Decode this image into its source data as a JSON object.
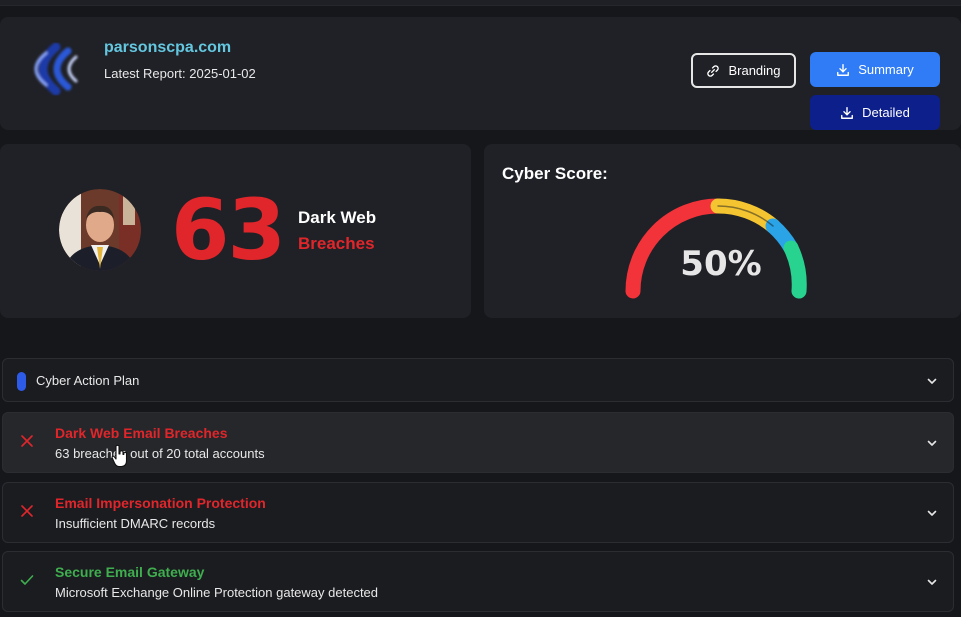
{
  "header": {
    "site_name": "parsonscpa.com",
    "latest_report_label": "Latest Report: 2025-01-02",
    "buttons": {
      "branding": "Branding",
      "summary": "Summary",
      "detailed": "Detailed"
    }
  },
  "breaches_card": {
    "count": "63",
    "label_line1": "Dark Web",
    "label_line2": "Breaches"
  },
  "score_card": {
    "title": "Cyber Score:",
    "value_text": "50%",
    "value": 50
  },
  "action_plan": {
    "label": "Cyber Action Plan"
  },
  "checks": [
    {
      "title": "Dark Web Email Breaches",
      "detail": "63 breaches out of 20 total accounts",
      "status": "fail"
    },
    {
      "title": "Email Impersonation Protection",
      "detail": "Insufficient DMARC records",
      "status": "fail"
    },
    {
      "title": "Secure Email Gateway",
      "detail": "Microsoft Exchange Online Protection gateway detected",
      "status": "pass"
    }
  ],
  "colors": {
    "accent_blue": "#2f7cf6",
    "dark_blue": "#0d1f8a",
    "danger": "#e0262b",
    "success": "#3fae4f",
    "link_cyan": "#64c7e0",
    "gauge_red": "#f2333a",
    "gauge_yellow": "#f5c531",
    "gauge_blue": "#2aa4e6",
    "gauge_green": "#27d38f"
  },
  "icons": {
    "branding": "link-icon",
    "summary": "download-icon",
    "detailed": "download-icon",
    "fail": "x-icon",
    "pass": "check-icon",
    "expand": "chevron-down-icon"
  }
}
